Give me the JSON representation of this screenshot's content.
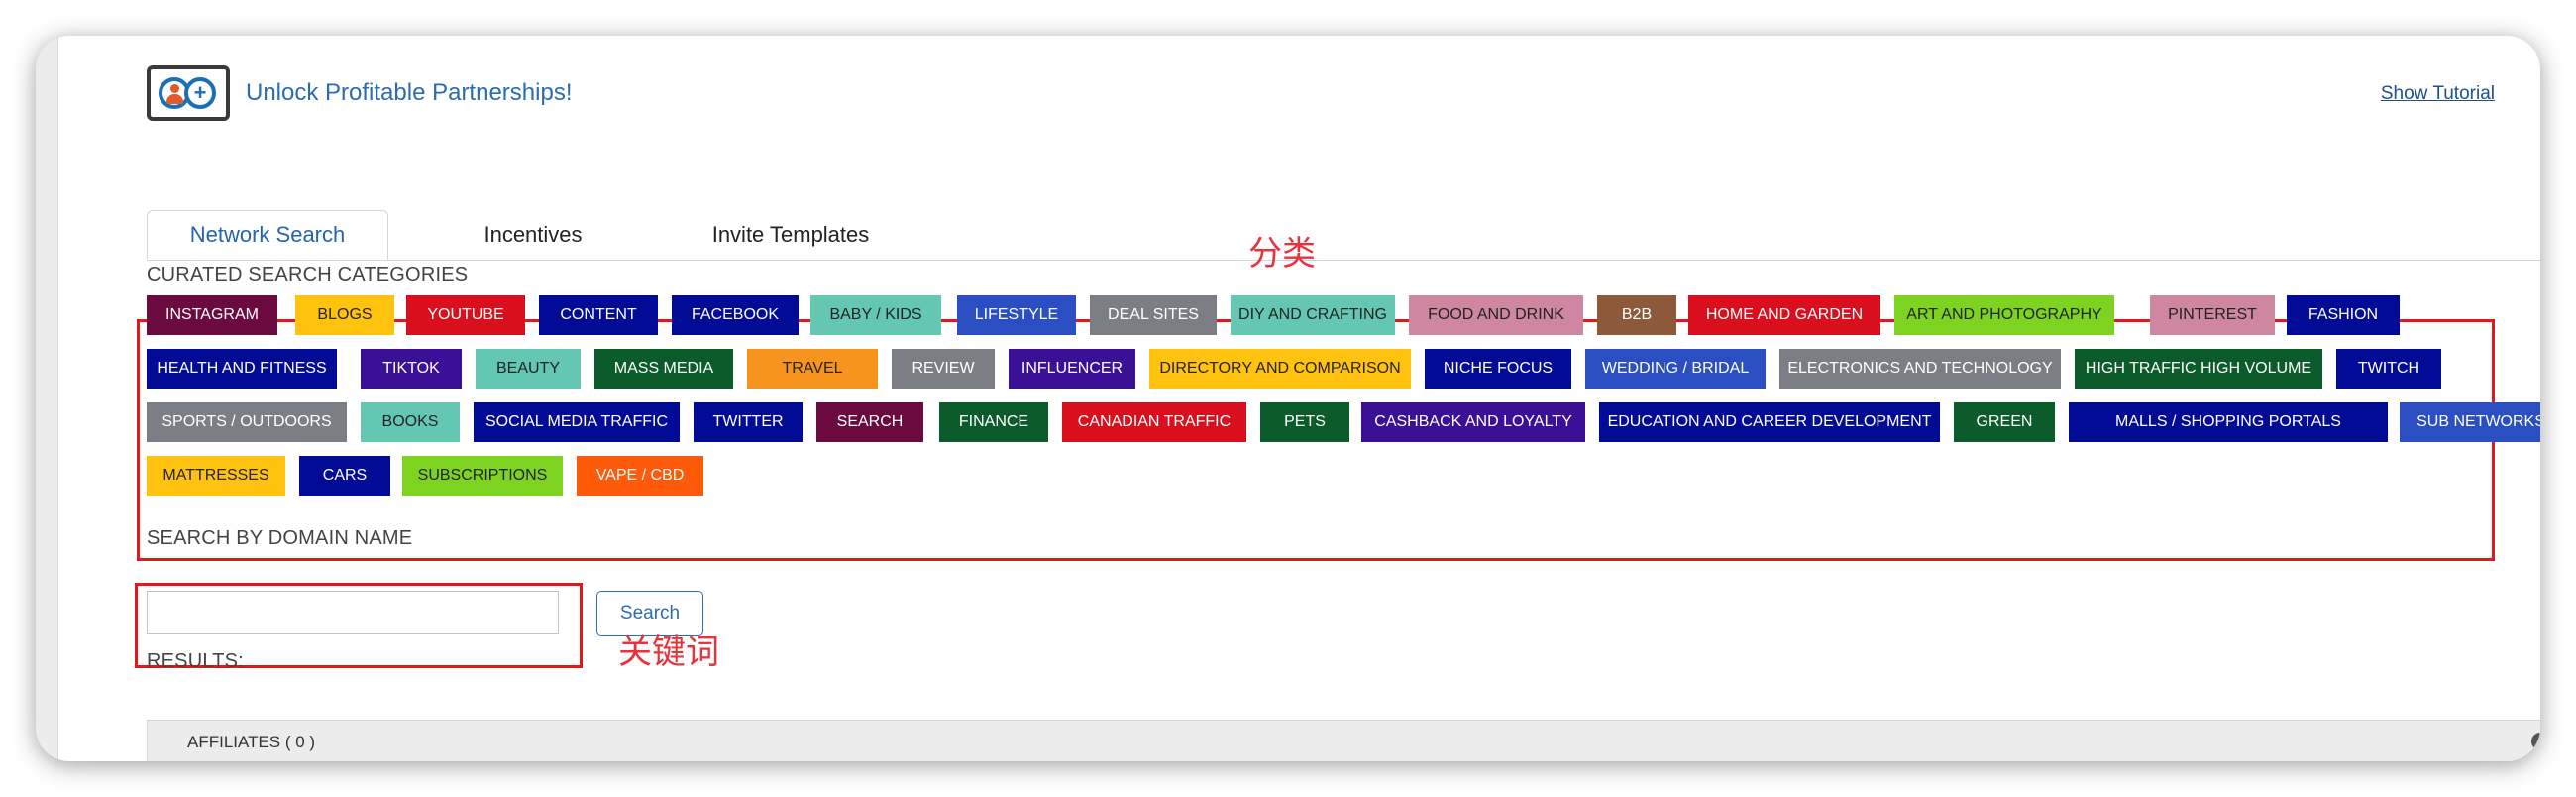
{
  "header": {
    "title": "Unlock Profitable Partnerships!",
    "tutorial_link": "Show Tutorial",
    "logo_icon": "partnership-logo-icon"
  },
  "tabs": [
    {
      "label": "Network Search",
      "active": true
    },
    {
      "label": "Incentives",
      "active": false
    },
    {
      "label": "Invite Templates",
      "active": false
    }
  ],
  "categories": {
    "section_label": "CURATED SEARCH CATEGORIES",
    "annotation": "分类",
    "items": [
      {
        "label": "INSTAGRAM",
        "bg": "#6b0a3e",
        "fg": "#ffffff"
      },
      {
        "label": "BLOGS",
        "bg": "#ffc20e",
        "fg": "#222222"
      },
      {
        "label": "YOUTUBE",
        "bg": "#d90f1e",
        "fg": "#ffffff"
      },
      {
        "label": "CONTENT",
        "bg": "#020b96",
        "fg": "#ffffff"
      },
      {
        "label": "FACEBOOK",
        "bg": "#020b96",
        "fg": "#ffffff"
      },
      {
        "label": "BABY / KIDS",
        "bg": "#63c7b2",
        "fg": "#222222"
      },
      {
        "label": "LIFESTYLE",
        "bg": "#2b4fc2",
        "fg": "#ffffff"
      },
      {
        "label": "DEAL SITES",
        "bg": "#7b7f85",
        "fg": "#ffffff"
      },
      {
        "label": "DIY AND CRAFTING",
        "bg": "#63c7b2",
        "fg": "#222222"
      },
      {
        "label": "FOOD AND DRINK",
        "bg": "#cf86a0",
        "fg": "#222222"
      },
      {
        "label": "B2B",
        "bg": "#8c5a3a",
        "fg": "#ffffff"
      },
      {
        "label": "HOME AND GARDEN",
        "bg": "#d90f1e",
        "fg": "#ffffff"
      },
      {
        "label": "ART AND PHOTOGRAPHY",
        "bg": "#7ed321",
        "fg": "#222222"
      },
      {
        "label": "PINTEREST",
        "bg": "#cf86a0",
        "fg": "#222222"
      },
      {
        "label": "FASHION",
        "bg": "#020b96",
        "fg": "#ffffff"
      },
      {
        "label": "HEALTH AND FITNESS",
        "bg": "#020b96",
        "fg": "#ffffff"
      },
      {
        "label": "TIKTOK",
        "bg": "#3b0f96",
        "fg": "#ffffff"
      },
      {
        "label": "BEAUTY",
        "bg": "#63c7b2",
        "fg": "#222222"
      },
      {
        "label": "MASS MEDIA",
        "bg": "#0b5c2a",
        "fg": "#ffffff"
      },
      {
        "label": "TRAVEL",
        "bg": "#f7941d",
        "fg": "#222222"
      },
      {
        "label": "REVIEW",
        "bg": "#7b7f85",
        "fg": "#ffffff"
      },
      {
        "label": "INFLUENCER",
        "bg": "#3b0f96",
        "fg": "#ffffff"
      },
      {
        "label": "DIRECTORY AND COMPARISON",
        "bg": "#ffc20e",
        "fg": "#222222"
      },
      {
        "label": "NICHE FOCUS",
        "bg": "#020b96",
        "fg": "#ffffff"
      },
      {
        "label": "WEDDING / BRIDAL",
        "bg": "#2b4fc2",
        "fg": "#ffffff"
      },
      {
        "label": "ELECTRONICS AND TECHNOLOGY",
        "bg": "#7b7f85",
        "fg": "#ffffff"
      },
      {
        "label": "HIGH TRAFFIC HIGH VOLUME",
        "bg": "#0b5c2a",
        "fg": "#ffffff"
      },
      {
        "label": "TWITCH",
        "bg": "#020b96",
        "fg": "#ffffff"
      },
      {
        "label": "SPORTS / OUTDOORS",
        "bg": "#7b7f85",
        "fg": "#ffffff"
      },
      {
        "label": "BOOKS",
        "bg": "#63c7b2",
        "fg": "#222222"
      },
      {
        "label": "SOCIAL MEDIA TRAFFIC",
        "bg": "#020b96",
        "fg": "#ffffff"
      },
      {
        "label": "TWITTER",
        "bg": "#020b96",
        "fg": "#ffffff"
      },
      {
        "label": "SEARCH",
        "bg": "#6b0a3e",
        "fg": "#ffffff"
      },
      {
        "label": "FINANCE",
        "bg": "#0b5c2a",
        "fg": "#ffffff"
      },
      {
        "label": "CANADIAN TRAFFIC",
        "bg": "#d90f1e",
        "fg": "#ffffff"
      },
      {
        "label": "PETS",
        "bg": "#0b5c2a",
        "fg": "#ffffff"
      },
      {
        "label": "CASHBACK AND LOYALTY",
        "bg": "#3b0f96",
        "fg": "#ffffff"
      },
      {
        "label": "EDUCATION AND CAREER DEVELOPMENT",
        "bg": "#020b96",
        "fg": "#ffffff"
      },
      {
        "label": "GREEN",
        "bg": "#0b5c2a",
        "fg": "#ffffff"
      },
      {
        "label": "MALLS / SHOPPING PORTALS",
        "bg": "#020b96",
        "fg": "#ffffff"
      },
      {
        "label": "SUB NETWORKS",
        "bg": "#2b4fc2",
        "fg": "#ffffff"
      },
      {
        "label": "MATTRESSES",
        "bg": "#ffc20e",
        "fg": "#222222"
      },
      {
        "label": "CARS",
        "bg": "#020b96",
        "fg": "#ffffff"
      },
      {
        "label": "SUBSCRIPTIONS",
        "bg": "#7ed321",
        "fg": "#222222"
      },
      {
        "label": "VAPE / CBD",
        "bg": "#ff5a0a",
        "fg": "#ffffff"
      }
    ]
  },
  "domain_search": {
    "section_label": "SEARCH BY DOMAIN NAME",
    "input_value": "",
    "button_label": "Search",
    "annotation": "关键词"
  },
  "results": {
    "section_label": "RESULTS:",
    "affiliates_label": "AFFILIATES ( 0 )",
    "collapse_icon": "chevron-up-circle-icon"
  }
}
